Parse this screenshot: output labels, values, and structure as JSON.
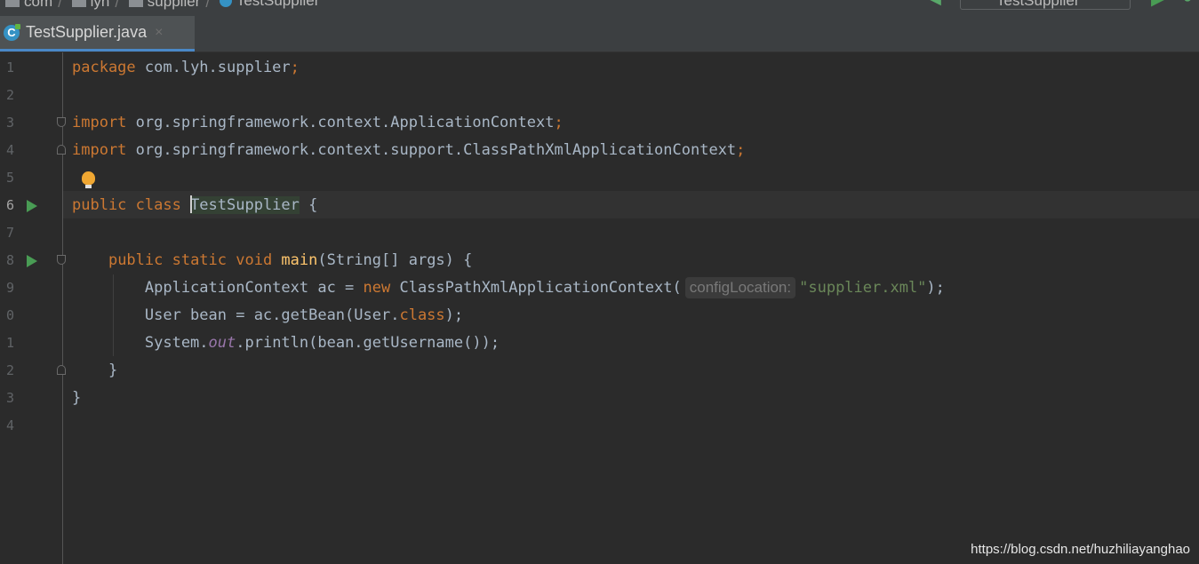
{
  "breadcrumbs": [
    "com",
    "lyh",
    "supplier",
    "TestSupplier"
  ],
  "run_config": "TestSupplier",
  "tab": {
    "label": "TestSupplier.java",
    "close": "×"
  },
  "line_numbers": [
    "1",
    "2",
    "3",
    "4",
    "5",
    "6",
    "7",
    "8",
    "9",
    "0",
    "1",
    "2",
    "3",
    "4"
  ],
  "code": {
    "l1_kw": "package",
    "l1_rest": " com.lyh.supplier",
    "l1_semi": ";",
    "l3_kw": "import",
    "l3_rest": " org.springframework.context.ApplicationContext",
    "l3_semi": ";",
    "l4_kw": "import",
    "l4_rest": " org.springframework.context.support.ClassPathXmlApplicationContext",
    "l4_semi": ";",
    "l6_kw": "public class ",
    "l6_class": "TestSupplier",
    "l6_rest": " {",
    "l8_indent": "    ",
    "l8_kw": "public static void ",
    "l8_fn": "main",
    "l8_rest": "(String[] args) {",
    "l9_a": "        ApplicationContext ac = ",
    "l9_kw": "new",
    "l9_b": " ClassPathXmlApplicationContext(",
    "l9_hint": "configLocation:",
    "l9_str": "\"supplier.xml\"",
    "l9_c": ");",
    "l10_a": "        User bean = ac.getBean(User.",
    "l10_kw": "class",
    "l10_b": ");",
    "l11_a": "        System.",
    "l11_static": "out",
    "l11_b": ".println(bean.getUsername());",
    "l12": "    }",
    "l13": "}"
  },
  "watermark": "https://blog.csdn.net/huzhiliayanghao",
  "colors": {
    "background": "#2b2b2b",
    "keyword": "#cc7832",
    "string": "#6a8759",
    "function": "#ffc66d",
    "text": "#a9b7c6"
  }
}
